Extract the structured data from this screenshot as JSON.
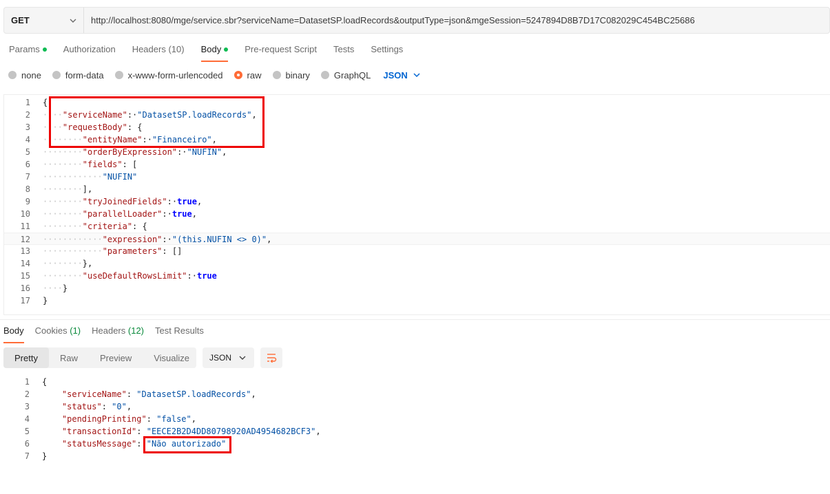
{
  "request": {
    "method": "GET",
    "url": "http://localhost:8080/mge/service.sbr?serviceName=DatasetSP.loadRecords&outputType=json&mgeSession=5247894D8B7D17C082029C454BC25686"
  },
  "request_tabs": [
    {
      "label": "Params"
    },
    {
      "label": "Authorization"
    },
    {
      "label": "Headers",
      "count": "(10)"
    },
    {
      "label": "Body"
    },
    {
      "label": "Pre-request Script"
    },
    {
      "label": "Tests"
    },
    {
      "label": "Settings"
    }
  ],
  "body_types": [
    "none",
    "form-data",
    "x-www-form-urlencoded",
    "raw",
    "binary",
    "GraphQL"
  ],
  "body_format": "JSON",
  "request_body": {
    "line_numbers": [
      "1",
      "2",
      "3",
      "4",
      "5",
      "6",
      "7",
      "8",
      "9",
      "10",
      "11",
      "12",
      "13",
      "14",
      "15",
      "16",
      "17"
    ],
    "l1_code": "{",
    "l2_key": "\"serviceName\"",
    "l2_val": "\"DatasetSP.loadRecords\"",
    "l3_key": "\"requestBody\"",
    "l3_rest": ": {",
    "l4_key": "\"entityName\"",
    "l4_val": "\"Financeiro\"",
    "l5_key": "\"orderByExpression\"",
    "l5_val": "\"NUFIN\"",
    "l6_key": "\"fields\"",
    "l6_rest": ": [",
    "l7_val": "\"NUFIN\"",
    "l8_code": "],",
    "l9_key": "\"tryJoinedFields\"",
    "l9_val": "true",
    "l10_key": "\"parallelLoader\"",
    "l10_val": "true",
    "l11_key": "\"criteria\"",
    "l11_rest": ": {",
    "l12_key": "\"expression\"",
    "l12_val": "\"(this.NUFIN <> 0)\"",
    "l13_key": "\"parameters\"",
    "l13_rest": ": []",
    "l14_code": "},",
    "l15_key": "\"useDefaultRowsLimit\"",
    "l15_val": "true",
    "l16_code": "}",
    "l17_code": "}"
  },
  "response_tabs": [
    {
      "label": "Body"
    },
    {
      "label": "Cookies",
      "count": "(1)"
    },
    {
      "label": "Headers",
      "count": "(12)"
    },
    {
      "label": "Test Results"
    }
  ],
  "view_modes": [
    "Pretty",
    "Raw",
    "Preview",
    "Visualize"
  ],
  "response_format": "JSON",
  "response_body": {
    "line_numbers": [
      "1",
      "2",
      "3",
      "4",
      "5",
      "6",
      "7"
    ],
    "r1": "{",
    "r2_key": "\"serviceName\"",
    "r2_val": "\"DatasetSP.loadRecords\"",
    "r3_key": "\"status\"",
    "r3_val": "\"0\"",
    "r4_key": "\"pendingPrinting\"",
    "r4_val": "\"false\"",
    "r5_key": "\"transactionId\"",
    "r5_val": "\"EECE2B2D4DD80798920AD4954682BCF3\"",
    "r6_key": "\"statusMessage\"",
    "r6_val": "\"Não autorizado\"",
    "r7": "}"
  },
  "colors": {
    "accent": "#ff6c37",
    "json_blue": "#0265d2",
    "status_green": "#0cbb52",
    "highlight_red": "#ee0000"
  }
}
